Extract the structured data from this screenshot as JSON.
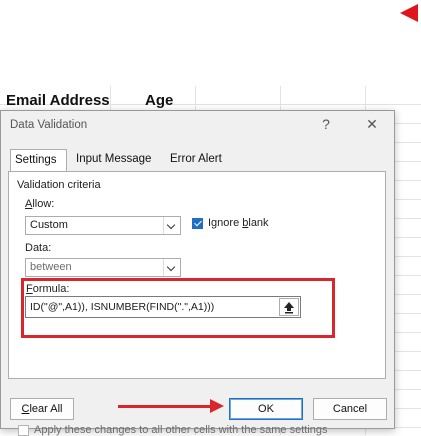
{
  "sheet": {
    "headers": [
      "Email Address",
      "Age"
    ]
  },
  "dialog": {
    "title": "Data Validation",
    "help_label": "?",
    "close_label": "✕",
    "tabs": [
      "Settings",
      "Input Message",
      "Error Alert"
    ],
    "active_tab": "Settings",
    "group_label": "Validation criteria",
    "allow_label": "Allow:",
    "allow_value": "Custom",
    "ignore_blank_label": "Ignore blank",
    "ignore_blank_checked": true,
    "data_label": "Data:",
    "data_value": "between",
    "formula_label": "Formula:",
    "formula_value": "ID(\"@\",A1)), ISNUMBER(FIND(\".\",A1)))",
    "apply_all_label": "Apply these changes to all other cells with the same settings",
    "apply_all_checked": false,
    "clear_all_label": "Clear All",
    "ok_label": "OK",
    "cancel_label": "Cancel"
  },
  "icons": {
    "ref_button": "collapse-up-arrow-icon",
    "annotation": "red-arrow-icon"
  },
  "colors": {
    "highlight": "#d8262c",
    "accent": "#1f6fc5",
    "dialog_bg": "#f0f0f0"
  }
}
